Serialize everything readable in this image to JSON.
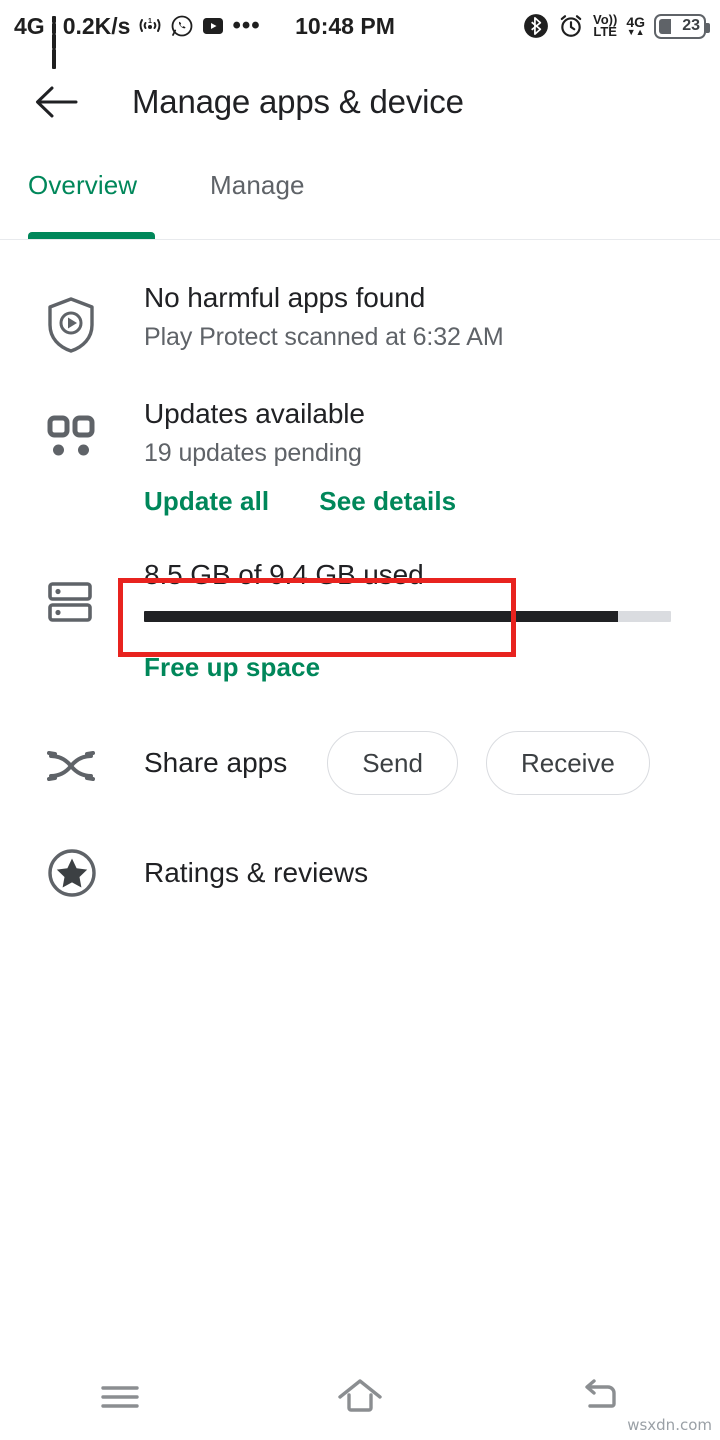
{
  "status_bar": {
    "network_type": "4G",
    "data_speed": "0.2K/s",
    "time": "10:48 PM",
    "volte_top": "Vo))",
    "volte_bottom": "LTE",
    "sim_network": "4G",
    "data_arrows": "▼▲",
    "battery_percent": "23",
    "overflow_dots": "•••",
    "icons": {
      "signal": "signal-bars-icon",
      "hotspot": "hotspot-icon",
      "whatsapp": "whatsapp-icon",
      "youtube": "youtube-icon",
      "bluetooth": "bluetooth-icon",
      "alarm": "alarm-clock-icon"
    }
  },
  "app_bar": {
    "back_label": "Back",
    "title": "Manage apps & device"
  },
  "tabs": [
    {
      "label": "Overview",
      "active": true
    },
    {
      "label": "Manage",
      "active": false
    }
  ],
  "play_protect": {
    "title": "No harmful apps found",
    "subtitle": "Play Protect scanned at 6:32 AM"
  },
  "updates": {
    "title": "Updates available",
    "subtitle": "19 updates pending",
    "update_all_label": "Update all",
    "see_details_label": "See details"
  },
  "storage": {
    "title": "8.5 GB of 9.4 GB used",
    "used_gb": 8.5,
    "total_gb": 9.4,
    "percent_used": 90,
    "free_up_label": "Free up space"
  },
  "share_apps": {
    "label": "Share apps",
    "send_label": "Send",
    "receive_label": "Receive"
  },
  "ratings": {
    "label": "Ratings & reviews"
  },
  "nav_bar": {
    "recents_label": "Recents",
    "home_label": "Home",
    "back_label": "Back"
  },
  "annotation": {
    "color": "#e8231f"
  },
  "watermark": "wsxdn.com",
  "colors": {
    "accent_green": "#00875a",
    "text_primary": "#202124",
    "text_secondary": "#5f6368",
    "divider": "#e8eaed"
  }
}
